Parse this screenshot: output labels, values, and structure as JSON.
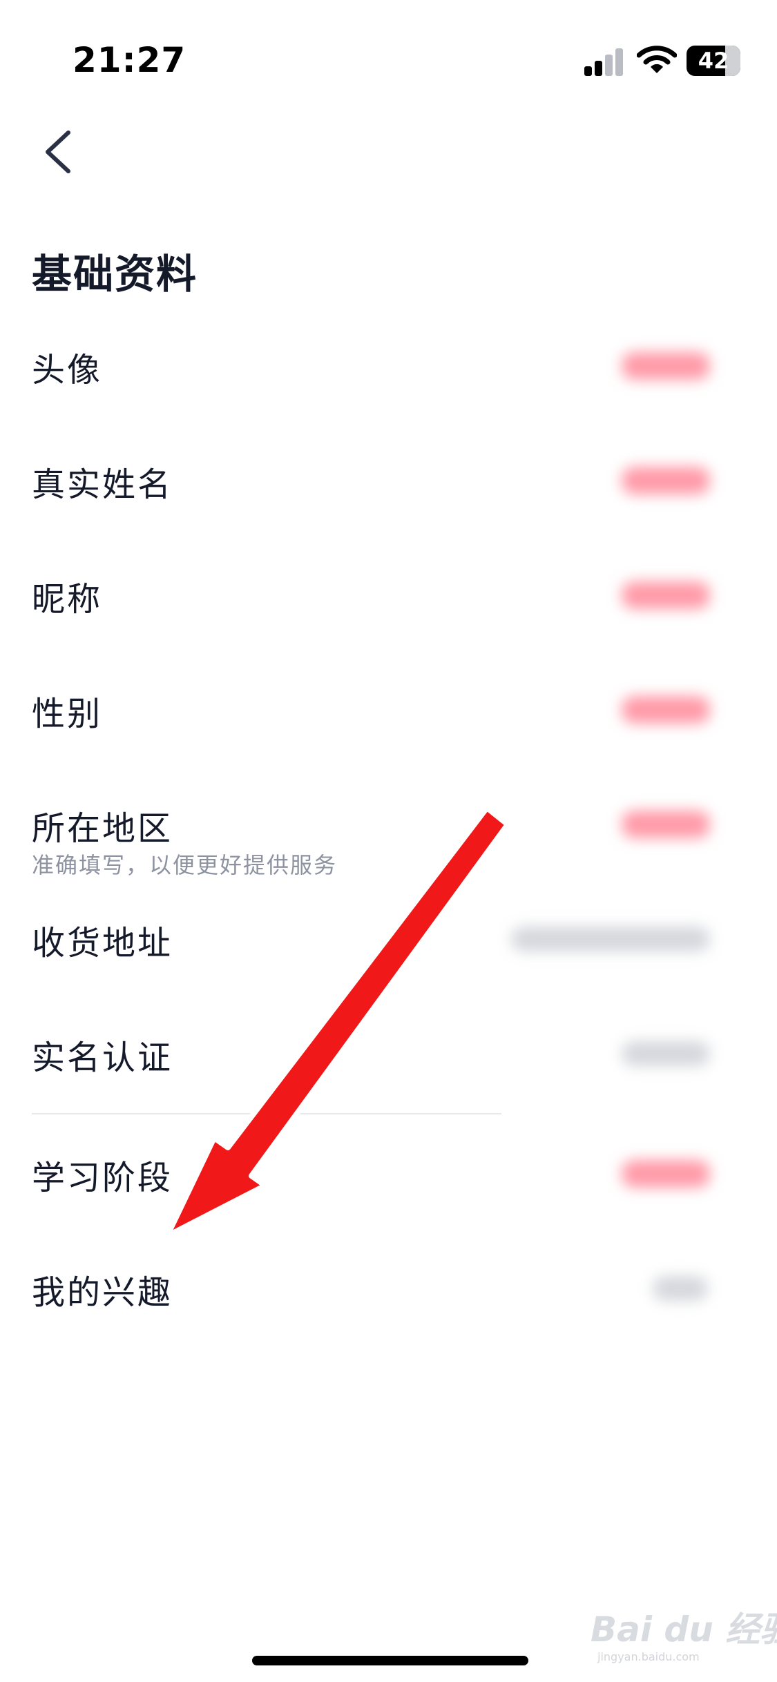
{
  "status_bar": {
    "time": "21:27",
    "battery": "42"
  },
  "header": {
    "back_icon": "chevron-left-icon"
  },
  "page": {
    "title": "基础资料"
  },
  "rows": [
    {
      "label": "头像",
      "value_tone": "red"
    },
    {
      "label": "真实姓名",
      "value_tone": "red"
    },
    {
      "label": "昵称",
      "value_tone": "red"
    },
    {
      "label": "性别",
      "value_tone": "red"
    },
    {
      "label": "所在地区",
      "sub": "准确填写，以便更好提供服务",
      "value_tone": "red"
    },
    {
      "label": "收货地址",
      "value_tone": "grey"
    },
    {
      "label": "实名认证",
      "value_tone": "grey"
    },
    {
      "label": "学习阶段",
      "value_tone": "red"
    },
    {
      "label": "我的兴趣",
      "value_tone": "grey"
    }
  ],
  "annotation": {
    "arrow_color": "#f01818"
  },
  "watermark": {
    "brand": "Bai du 经验",
    "site": "jingyan.baidu.com"
  }
}
